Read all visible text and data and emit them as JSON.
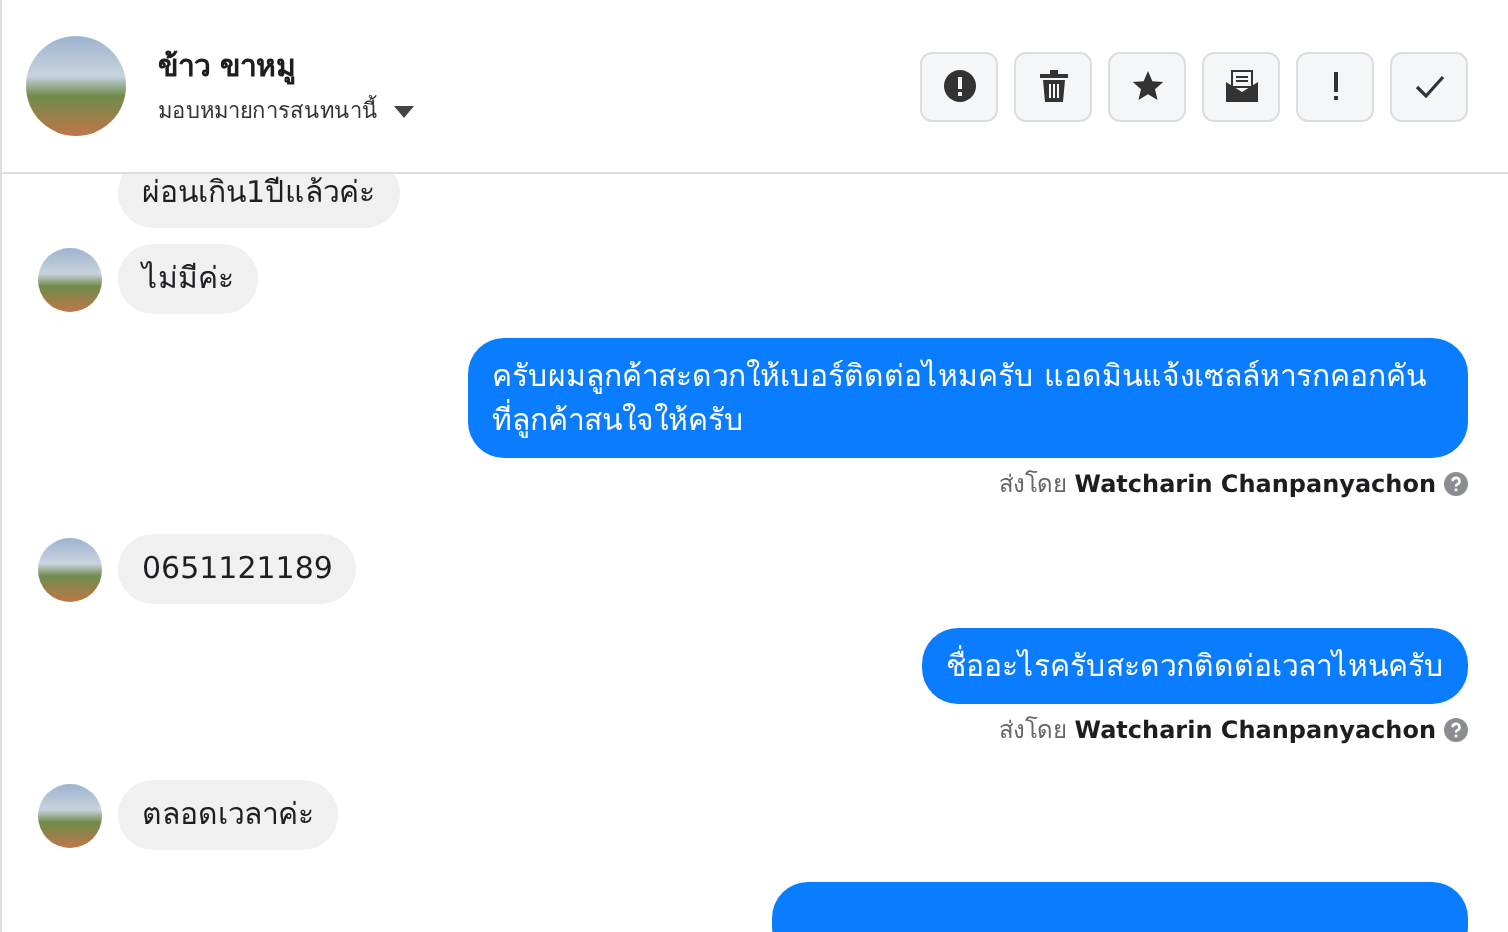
{
  "header": {
    "name": "ข้าว ขาหมู",
    "assign": "มอบหมายการสนทนานี้"
  },
  "messages": [
    {
      "kind": "incoming",
      "text": "ผ่อนเกิน1ปีแล้วค่ะ",
      "avatar": false
    },
    {
      "kind": "incoming",
      "text": "ไม่มีค่ะ",
      "avatar": true
    },
    {
      "kind": "outgoing",
      "text": "ครับผมลูกค้าสะดวกให้เบอร์ติดต่อไหมครับ แอดมินแจ้งเซลล์หารกคอกคัน ที่ลูกค้าสนใจให้ครับ",
      "sender": "ส่งโดย **Watcharin Chanpanyachon**"
    },
    {
      "kind": "incoming",
      "text": "0651121189",
      "avatar": true
    },
    {
      "kind": "outgoing",
      "text": "ชื่ออะไรครับสะดวกติดต่อเวลาไหนครับ",
      "sender": "ส่งโดย **Watcharin Chanpanyachon**"
    },
    {
      "kind": "incoming",
      "text": "ตลอดเวลาค่ะ",
      "avatar": true
    },
    {
      "kind": "outgoing-cut"
    }
  ]
}
